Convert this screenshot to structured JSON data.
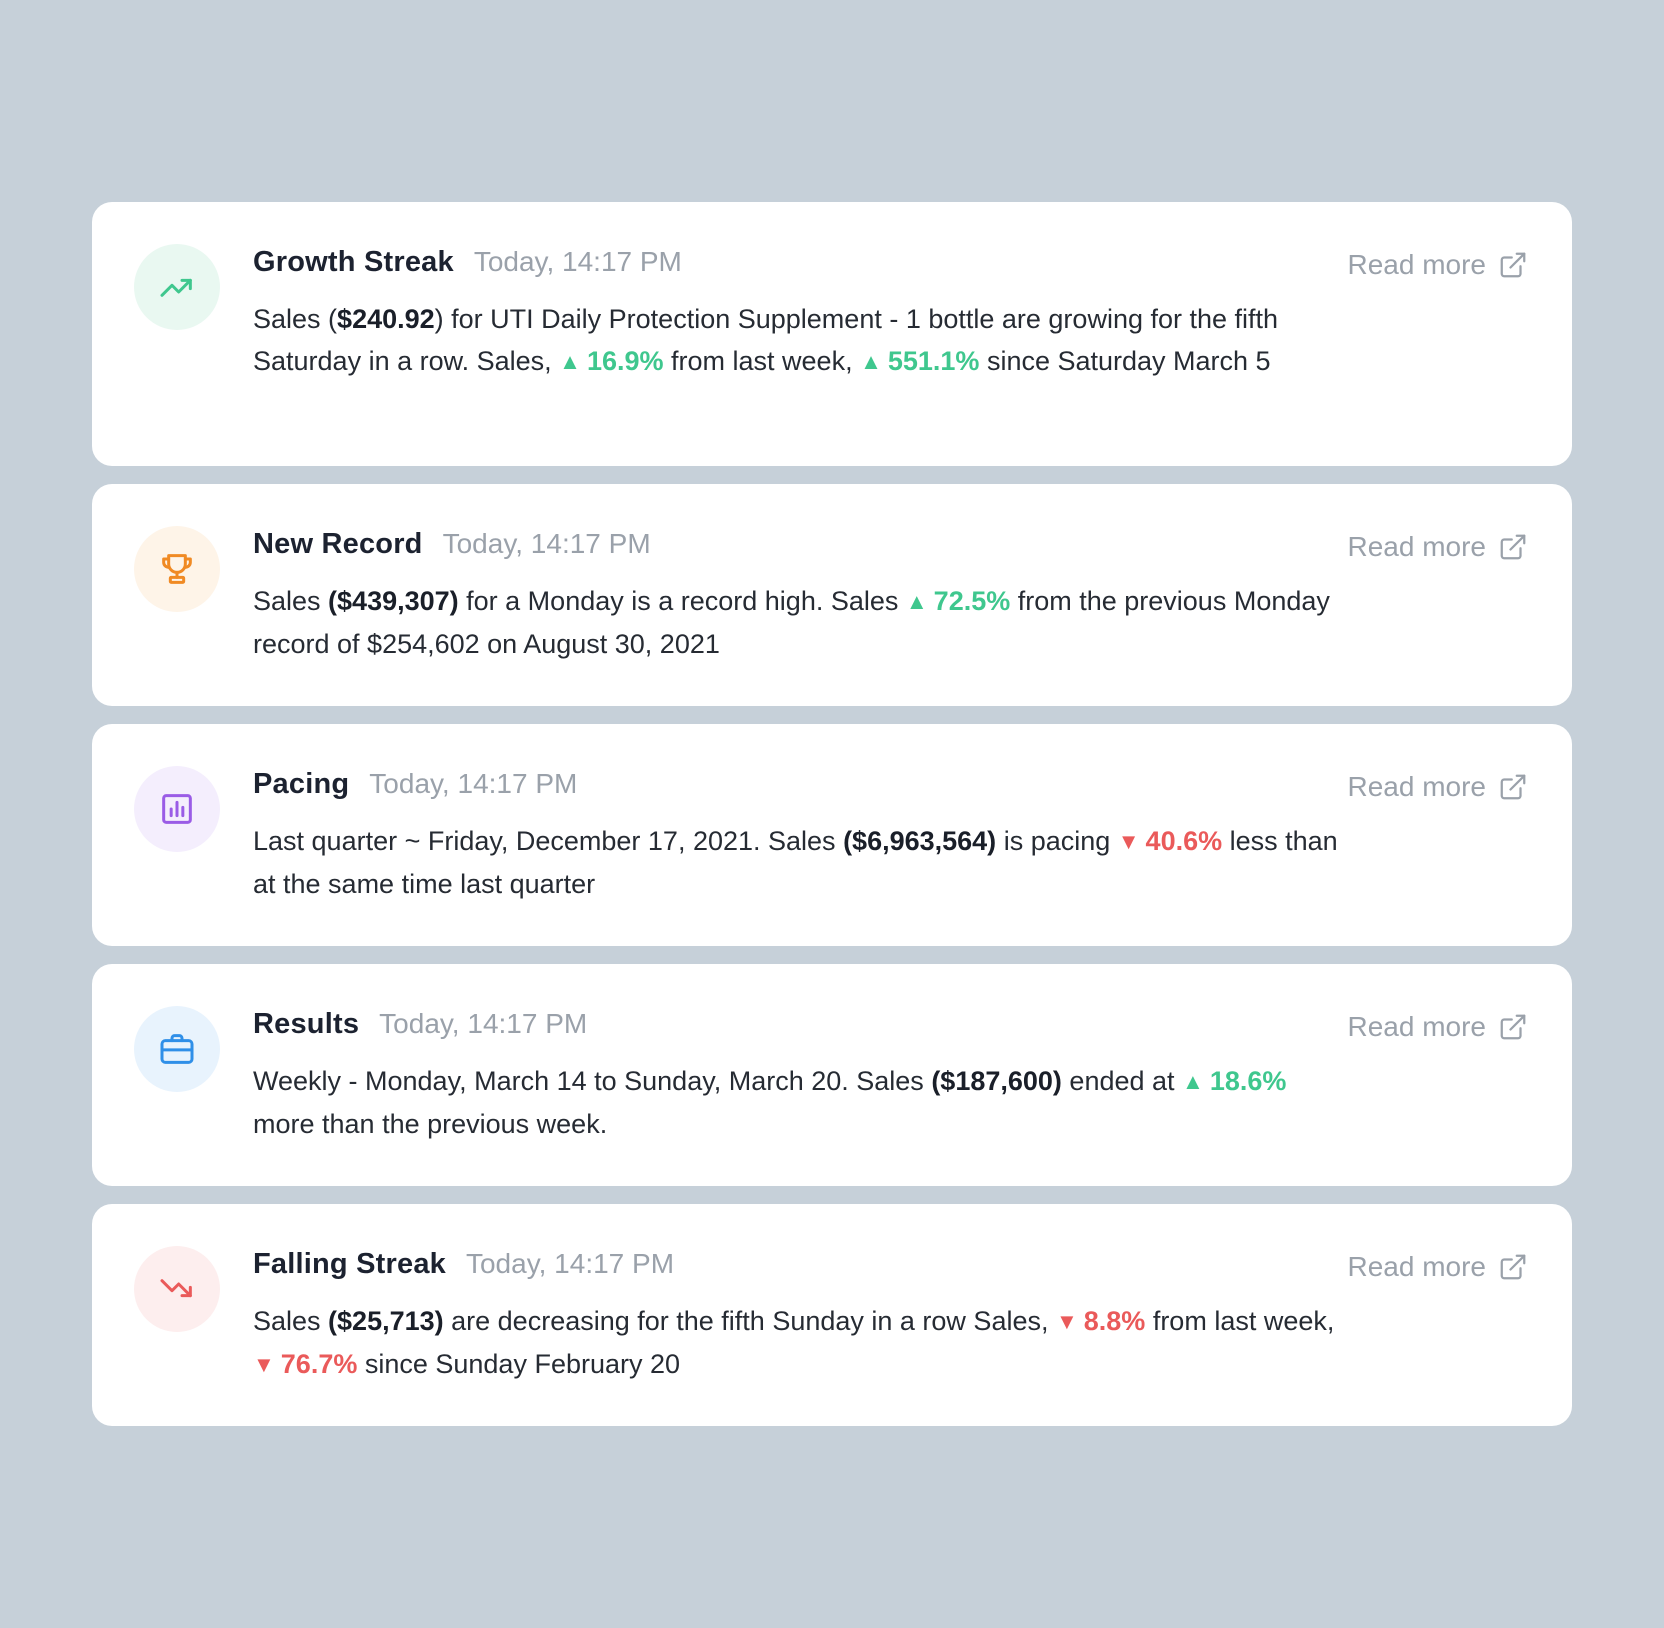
{
  "read_more_label": "Read more",
  "colors": {
    "up": "#3fc78e",
    "down": "#ea5a5a",
    "background": "#c6d0d9"
  },
  "cards": [
    {
      "icon": "trending-up-icon",
      "title": "Growth Streak",
      "time": "Today, 14:17 PM",
      "segments": [
        {
          "t": "Sales ("
        },
        {
          "t": "$240.92",
          "s": "b"
        },
        {
          "t": ") for UTI Daily Protection Supplement - 1 bottle are growing for the fifth Saturday in a row. Sales, "
        },
        {
          "t": "16.9%",
          "s": "up"
        },
        {
          "t": " from last week, "
        },
        {
          "t": "551.1%",
          "s": "up"
        },
        {
          "t": " since Saturday March 5"
        }
      ]
    },
    {
      "icon": "trophy-icon",
      "title": "New Record",
      "time": "Today, 14:17 PM",
      "segments": [
        {
          "t": "Sales "
        },
        {
          "t": "($439,307)",
          "s": "b"
        },
        {
          "t": " for a Monday is a record high.  Sales  "
        },
        {
          "t": "72.5%",
          "s": "up"
        },
        {
          "t": " from the previous Monday record of $254,602 on August 30, 2021"
        }
      ]
    },
    {
      "icon": "bar-chart-icon",
      "title": "Pacing",
      "time": "Today, 14:17 PM",
      "segments": [
        {
          "t": "Last quarter ~ Friday, December 17, 2021. Sales "
        },
        {
          "t": "($6,963,564)",
          "s": "b"
        },
        {
          "t": " is pacing "
        },
        {
          "t": "40.6%",
          "s": "down"
        },
        {
          "t": " less than at the same time last quarter"
        }
      ]
    },
    {
      "icon": "briefcase-icon",
      "title": "Results",
      "time": "Today, 14:17 PM",
      "segments": [
        {
          "t": "Weekly - Monday, March 14 to Sunday, March 20. Sales "
        },
        {
          "t": "($187,600)",
          "s": "b"
        },
        {
          "t": " ended at "
        },
        {
          "t": "18.6%",
          "s": "up"
        },
        {
          "t": " more than the previous week."
        }
      ]
    },
    {
      "icon": "trending-down-icon",
      "title": "Falling Streak",
      "time": "Today, 14:17 PM",
      "segments": [
        {
          "t": "Sales "
        },
        {
          "t": "($25,713)",
          "s": "b"
        },
        {
          "t": " are decreasing for the fifth Sunday in a row Sales, "
        },
        {
          "t": "8.8%",
          "s": "down"
        },
        {
          "t": " from last week, "
        },
        {
          "t": "76.7%",
          "s": "down"
        },
        {
          "t": " since Sunday February 20"
        }
      ]
    }
  ]
}
